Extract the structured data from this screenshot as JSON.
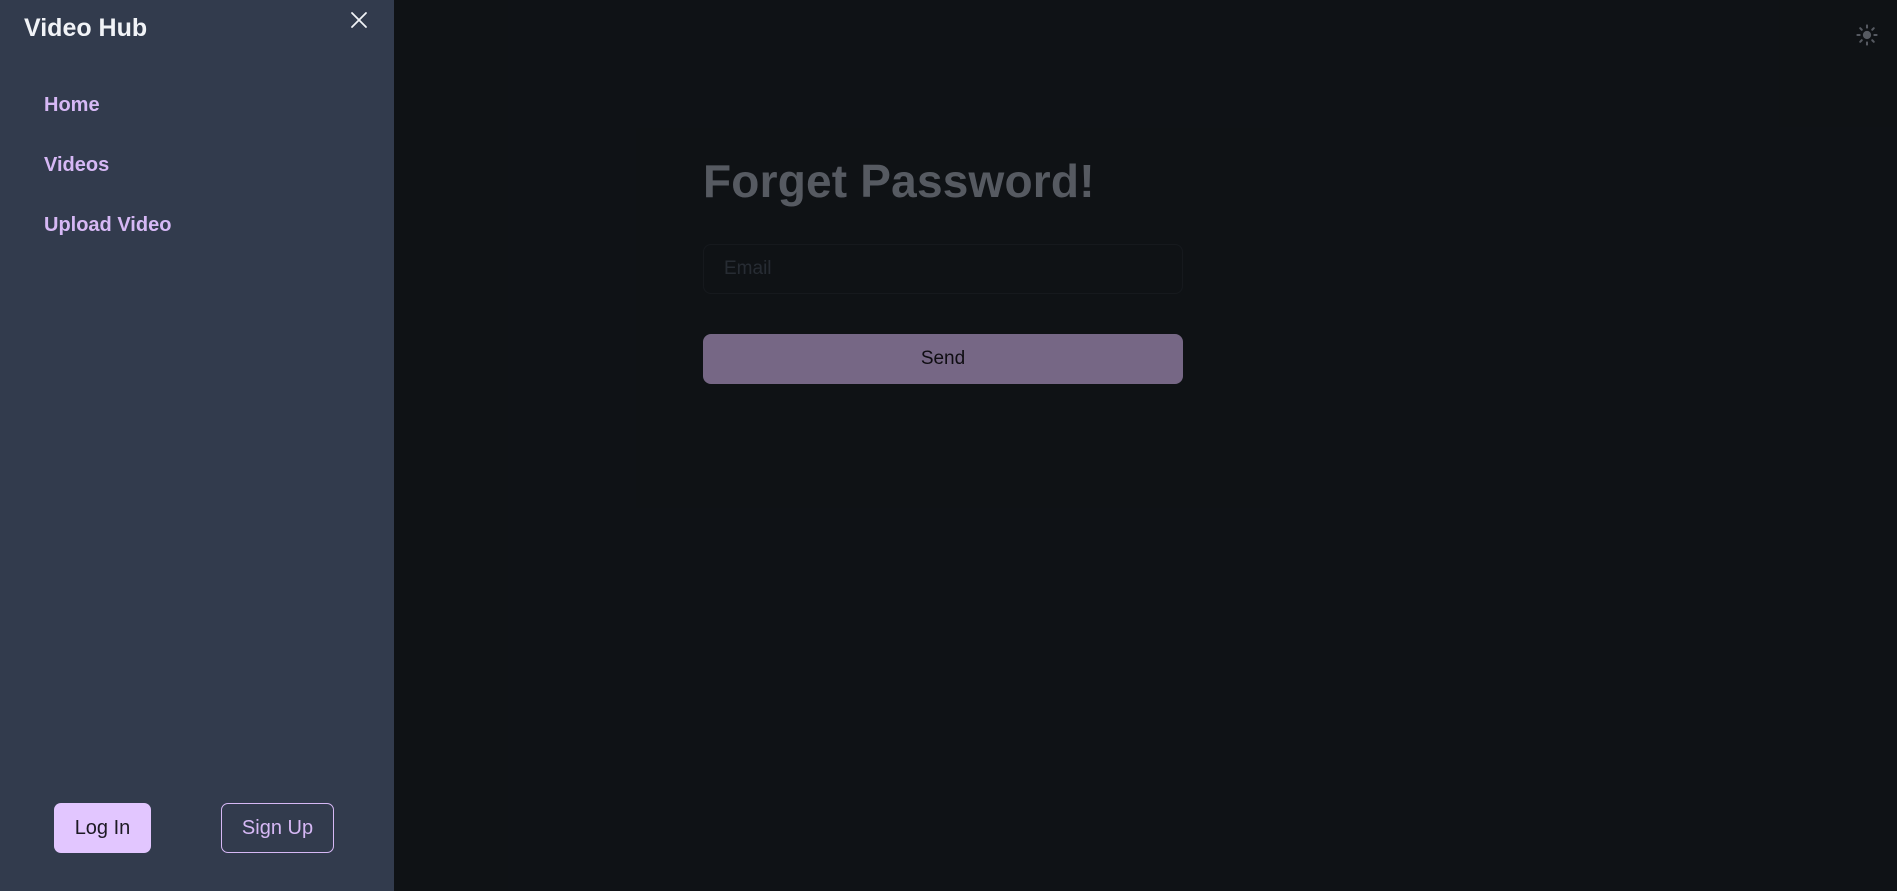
{
  "drawer": {
    "title": "Video Hub",
    "nav": [
      {
        "label": "Home"
      },
      {
        "label": "Videos"
      },
      {
        "label": "Upload Video"
      }
    ],
    "login_label": "Log In",
    "signup_label": "Sign Up",
    "close_icon": "close-icon"
  },
  "header": {
    "theme_icon": "sun-icon"
  },
  "form": {
    "title": "Forget Password!",
    "email_placeholder": "Email",
    "email_value": "",
    "submit_label": "Send"
  },
  "colors": {
    "background": "#1d232a",
    "drawer_bg": "#323b4d",
    "accent": "#e2c6ff",
    "nav_text": "#d6b8f5"
  }
}
